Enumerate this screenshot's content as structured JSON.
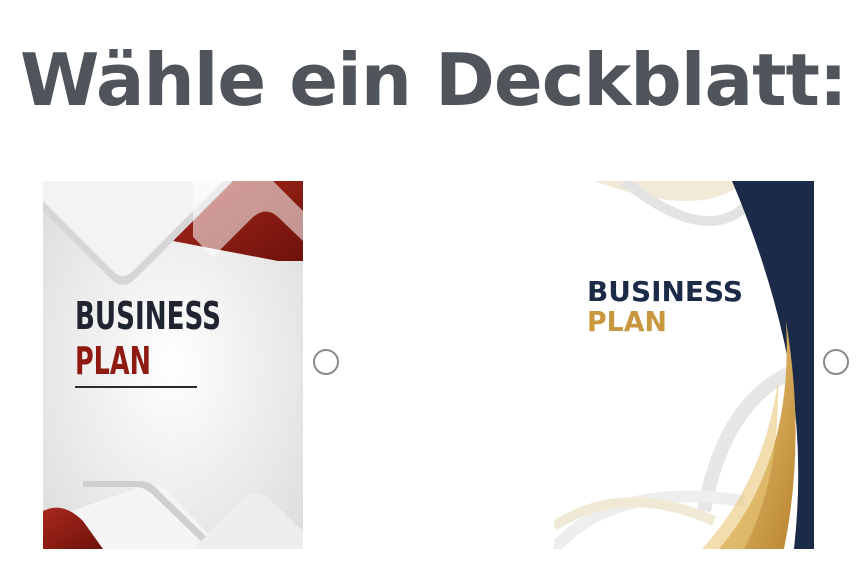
{
  "heading": "Wähle ein Deckblatt:",
  "covers": [
    {
      "line1": "BUSINESS",
      "line2": "PLAN",
      "selected": false,
      "colors": {
        "accent": "#8e1a12",
        "title": "#1f2430"
      }
    },
    {
      "line1": "BUSINESS",
      "line2": "PLAN",
      "selected": false,
      "colors": {
        "navy": "#1b2a47",
        "gold": "#c9973e",
        "title": "#1b2a47"
      }
    }
  ]
}
